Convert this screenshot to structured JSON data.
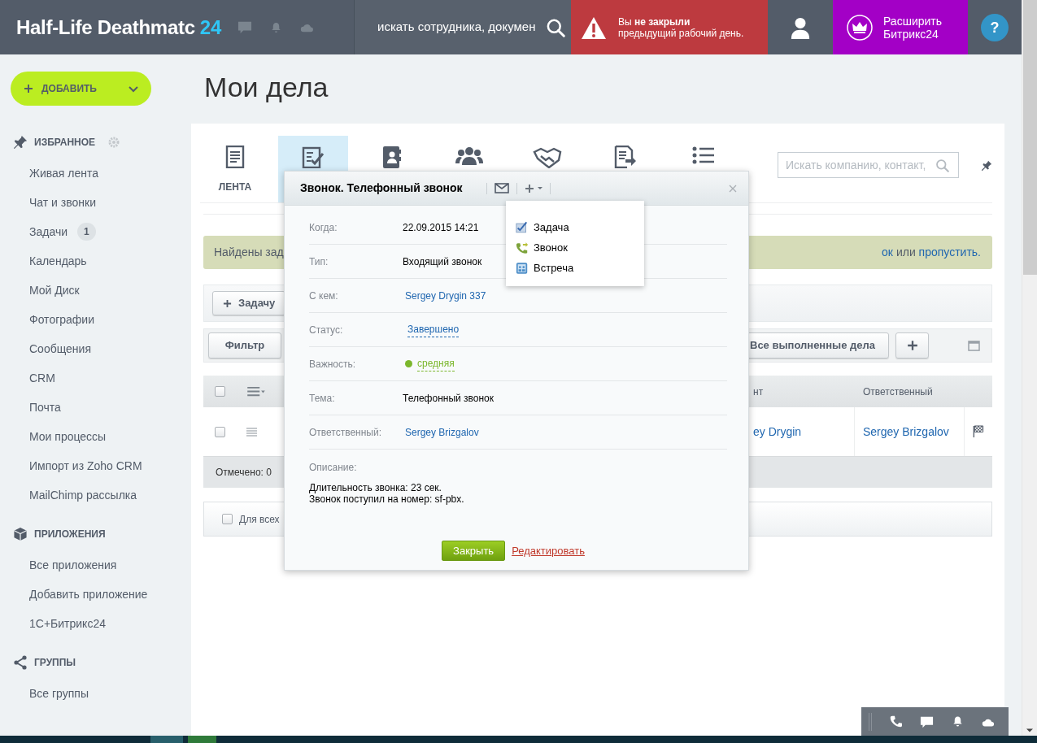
{
  "header": {
    "logo": "Half-Life Deathmatc",
    "logo_number": "24",
    "search": {
      "placeholder": "искать сотрудника, докумен"
    },
    "warning": {
      "lines": [
        "Вы **не закрыли**",
        "предыдущий рабочий день."
      ]
    },
    "upgrade": {
      "lines": [
        "Расширить",
        "Битрикс24"
      ]
    },
    "help": "?"
  },
  "sidebar": {
    "add_button": "ДОБАВИТЬ",
    "sections": [
      {
        "kind": "favorites",
        "title": "ИЗБРАННОЕ",
        "has_settings": true,
        "items": [
          {
            "label": "Живая лента"
          },
          {
            "label": "Чат и звонки"
          },
          {
            "label": "Задачи",
            "counter": "1"
          },
          {
            "label": "Календарь"
          },
          {
            "label": "Мой Диск"
          },
          {
            "label": "Фотографии"
          },
          {
            "label": "Сообщения"
          },
          {
            "label": "CRM"
          },
          {
            "label": "Почта"
          },
          {
            "label": "Мои процессы"
          },
          {
            "label": "Импорт из Zoho CRM"
          },
          {
            "label": "MailChimp рассылка"
          }
        ]
      },
      {
        "kind": "apps",
        "title": "ПРИЛОЖЕНИЯ",
        "has_settings": false,
        "items": [
          {
            "label": "Все приложения"
          },
          {
            "label": "Добавить приложение"
          },
          {
            "label": "1С+Битрикс24"
          }
        ]
      },
      {
        "kind": "groups",
        "title": "ГРУППЫ",
        "has_settings": false,
        "items": [
          {
            "label": "Все группы"
          }
        ]
      }
    ]
  },
  "page_title": "Мои дела",
  "tabs": [
    {
      "kind": "feed",
      "label": "ЛЕНТА",
      "selected": false
    },
    {
      "kind": "tasks",
      "selected": true
    },
    {
      "kind": "contacts",
      "selected": false
    },
    {
      "kind": "companies",
      "selected": false
    },
    {
      "kind": "deals",
      "selected": false
    },
    {
      "kind": "invoices",
      "selected": false
    },
    {
      "kind": "list",
      "selected": false
    }
  ],
  "crm_search": {
    "placeholder": "Искать компанию, контакт,"
  },
  "notice": {
    "left": "Найдены зад",
    "right": [
      {
        "kind": "link",
        "text": "ок"
      },
      {
        "kind": "text",
        "text": "или"
      },
      {
        "kind": "link",
        "text": "пропустить."
      }
    ]
  },
  "toolbar": {
    "add_task": "Задачу"
  },
  "filter": {
    "button": "Фильтр",
    "preset": "Все выполненные дела"
  },
  "table": {
    "select_all_checked": false,
    "columns": [
      {
        "label": "нт"
      },
      {
        "label": "Ответственный"
      }
    ],
    "rows": [
      {
        "checked": false,
        "contact": "ey Drygin",
        "responsible": "Sergey Brizgalov"
      }
    ],
    "footer": "Отмечено: 0"
  },
  "bulk": {
    "label": "Для всех",
    "checked": false
  },
  "popup": {
    "title": "Звонок. Телефонный звонок",
    "fields": [
      {
        "kind": "text",
        "label": "Когда:",
        "value": "22.09.2015 14:21"
      },
      {
        "kind": "text",
        "label": "Тип:",
        "value": "Входящий звонок"
      },
      {
        "kind": "link",
        "label": "С кем:",
        "value": "Sergey Drygin 337"
      },
      {
        "kind": "dashed_link",
        "label": "Статус:",
        "value": "Завершено"
      },
      {
        "kind": "priority",
        "label": "Важность:",
        "value": "средняя"
      },
      {
        "kind": "text",
        "label": "Тема:",
        "value": "Телефонный звонок"
      },
      {
        "kind": "link",
        "label": "Ответственный:",
        "value": "Sergey Brizgalov"
      }
    ],
    "description_label": "Описание:",
    "description": [
      "Длительность звонка: 23 сек.",
      "Звонок поступил на номер: sf-pbx."
    ],
    "close_button": "Закрыть",
    "edit_link": "Редактировать"
  },
  "add_menu": {
    "items": [
      {
        "kind": "task",
        "label": "Задача"
      },
      {
        "kind": "call",
        "label": "Звонок"
      },
      {
        "kind": "meeting",
        "label": "Встреча"
      }
    ]
  }
}
